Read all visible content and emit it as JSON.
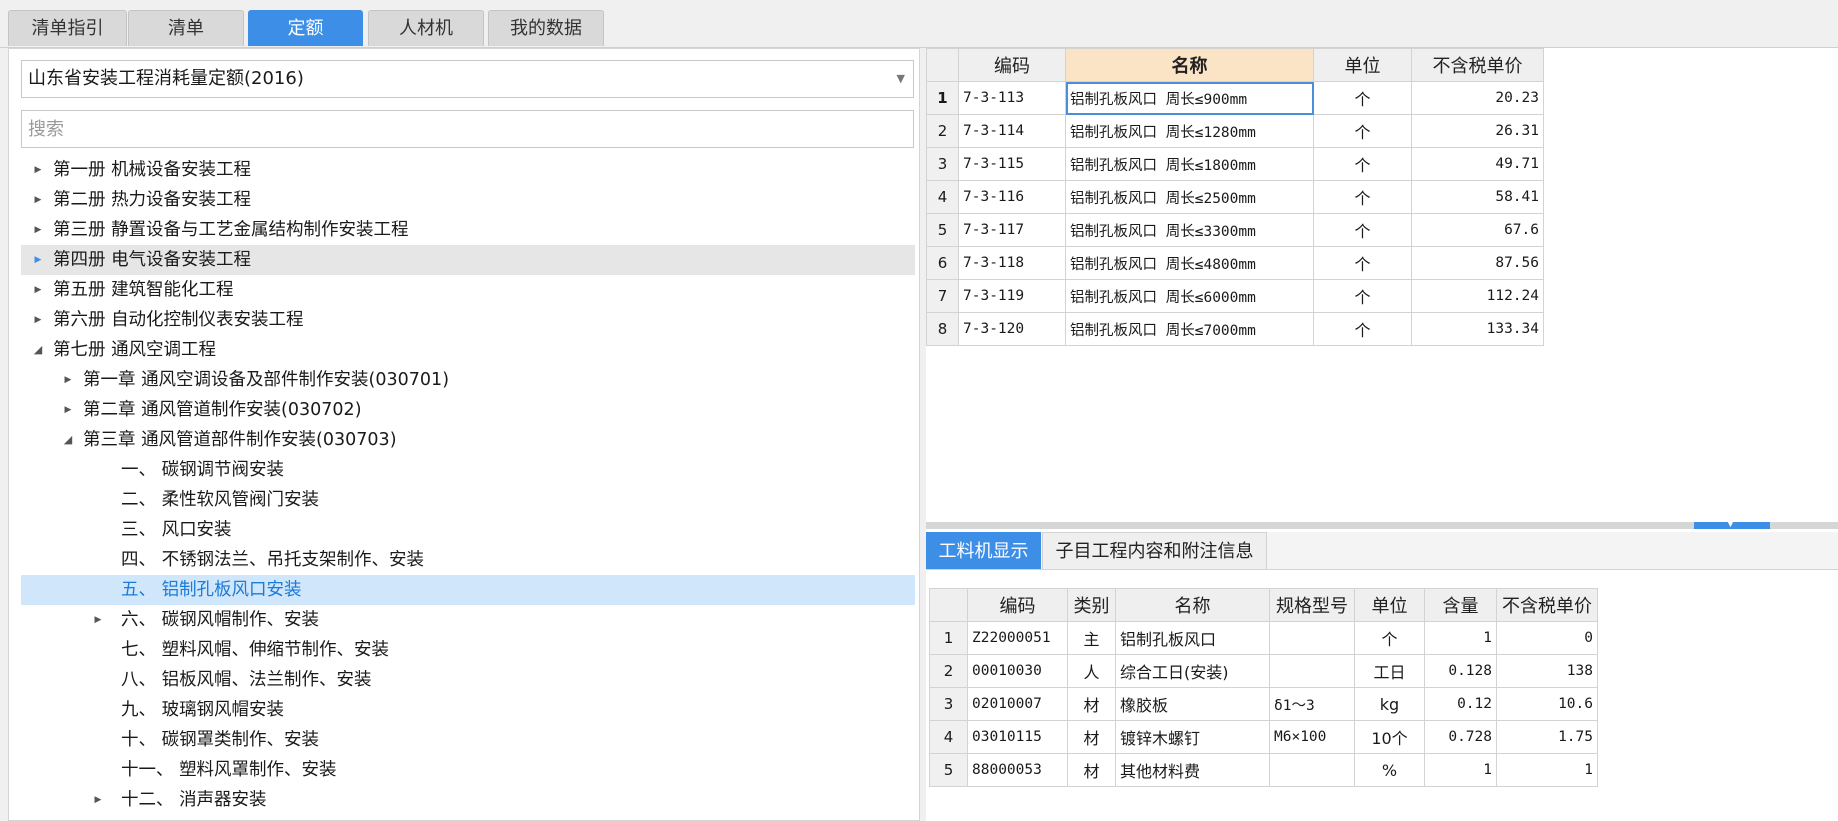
{
  "top_tabs": [
    "清单指引",
    "清单",
    "定额",
    "人材机",
    "我的数据"
  ],
  "active_tab": "定额",
  "left": {
    "library": "山东省安装工程消耗量定额(2016)",
    "search_placeholder": "搜索",
    "tree": [
      {
        "label": "第一册 机械设备安装工程",
        "level": 0,
        "toggle": "collapsed"
      },
      {
        "label": "第二册 热力设备安装工程",
        "level": 0,
        "toggle": "collapsed"
      },
      {
        "label": "第三册 静置设备与工艺金属结构制作安装工程",
        "level": 0,
        "toggle": "collapsed"
      },
      {
        "label": "第四册 电气设备安装工程",
        "level": 0,
        "toggle": "collapsed",
        "state": "hover"
      },
      {
        "label": "第五册 建筑智能化工程",
        "level": 0,
        "toggle": "collapsed"
      },
      {
        "label": "第六册 自动化控制仪表安装工程",
        "level": 0,
        "toggle": "collapsed"
      },
      {
        "label": "第七册 通风空调工程",
        "level": 0,
        "toggle": "expanded"
      },
      {
        "label": "第一章 通风空调设备及部件制作安装(030701)",
        "level": 1,
        "toggle": "collapsed"
      },
      {
        "label": "第二章 通风管道制作安装(030702)",
        "level": 1,
        "toggle": "collapsed"
      },
      {
        "label": "第三章 通风管道部件制作安装(030703)",
        "level": 1,
        "toggle": "expanded"
      },
      {
        "label": "一、 碳钢调节阀安装",
        "level": 2,
        "toggle": "none"
      },
      {
        "label": "二、 柔性软风管阀门安装",
        "level": 2,
        "toggle": "none"
      },
      {
        "label": "三、 风口安装",
        "level": 2,
        "toggle": "none"
      },
      {
        "label": "四、 不锈钢法兰、吊托支架制作、安装",
        "level": 2,
        "toggle": "none"
      },
      {
        "label": "五、 铝制孔板风口安装",
        "level": 2,
        "toggle": "none",
        "state": "selected"
      },
      {
        "label": "六、 碳钢风帽制作、安装",
        "level": 2,
        "toggle": "collapsed"
      },
      {
        "label": "七、 塑料风帽、伸缩节制作、安装",
        "level": 2,
        "toggle": "none"
      },
      {
        "label": "八、 铝板风帽、法兰制作、安装",
        "level": 2,
        "toggle": "none"
      },
      {
        "label": "九、 玻璃钢风帽安装",
        "level": 2,
        "toggle": "none"
      },
      {
        "label": "十、 碳钢罩类制作、安装",
        "level": 2,
        "toggle": "none"
      },
      {
        "label": "十一、 塑料风罩制作、安装",
        "level": 2,
        "toggle": "none"
      },
      {
        "label": "十二、 消声器安装",
        "level": 2,
        "toggle": "collapsed"
      }
    ]
  },
  "quota_table": {
    "columns": [
      "编码",
      "名称",
      "单位",
      "不含税单价"
    ],
    "rows": [
      {
        "no": "1",
        "code": "7-3-113",
        "name": "铝制孔板风口 周长≤900mm",
        "unit": "个",
        "price": "20.23"
      },
      {
        "no": "2",
        "code": "7-3-114",
        "name": "铝制孔板风口 周长≤1280mm",
        "unit": "个",
        "price": "26.31"
      },
      {
        "no": "3",
        "code": "7-3-115",
        "name": "铝制孔板风口 周长≤1800mm",
        "unit": "个",
        "price": "49.71"
      },
      {
        "no": "4",
        "code": "7-3-116",
        "name": "铝制孔板风口 周长≤2500mm",
        "unit": "个",
        "price": "58.41"
      },
      {
        "no": "5",
        "code": "7-3-117",
        "name": "铝制孔板风口 周长≤3300mm",
        "unit": "个",
        "price": "67.6"
      },
      {
        "no": "6",
        "code": "7-3-118",
        "name": "铝制孔板风口 周长≤4800mm",
        "unit": "个",
        "price": "87.56"
      },
      {
        "no": "7",
        "code": "7-3-119",
        "name": "铝制孔板风口 周长≤6000mm",
        "unit": "个",
        "price": "112.24"
      },
      {
        "no": "8",
        "code": "7-3-120",
        "name": "铝制孔板风口 周长≤7000mm",
        "unit": "个",
        "price": "133.34"
      }
    ]
  },
  "sub_tabs": [
    "工料机显示",
    "子目工程内容和附注信息"
  ],
  "resource_table": {
    "columns": [
      "编码",
      "类别",
      "名称",
      "规格型号",
      "单位",
      "含量",
      "不含税单价"
    ],
    "rows": [
      {
        "no": "1",
        "code": "Z22000051",
        "type": "主",
        "name": "铝制孔板风口",
        "spec": "",
        "unit": "个",
        "qty": "1",
        "price": "0"
      },
      {
        "no": "2",
        "code": "00010030",
        "type": "人",
        "name": "综合工日(安装)",
        "spec": "",
        "unit": "工日",
        "qty": "0.128",
        "price": "138"
      },
      {
        "no": "3",
        "code": "02010007",
        "type": "材",
        "name": "橡胶板",
        "spec": "δ1～3",
        "unit": "kg",
        "qty": "0.12",
        "price": "10.6"
      },
      {
        "no": "4",
        "code": "03010115",
        "type": "材",
        "name": "镀锌木螺钉",
        "spec": "M6×100",
        "unit": "10个",
        "qty": "0.728",
        "price": "1.75"
      },
      {
        "no": "5",
        "code": "88000053",
        "type": "材",
        "name": "其他材料费",
        "spec": "",
        "unit": "%",
        "qty": "1",
        "price": "1"
      }
    ]
  },
  "colors": {
    "accent": "#3d8ee6",
    "selected_row_bg": "#cfe6fb",
    "header_highlight": "#fbe3c5"
  }
}
